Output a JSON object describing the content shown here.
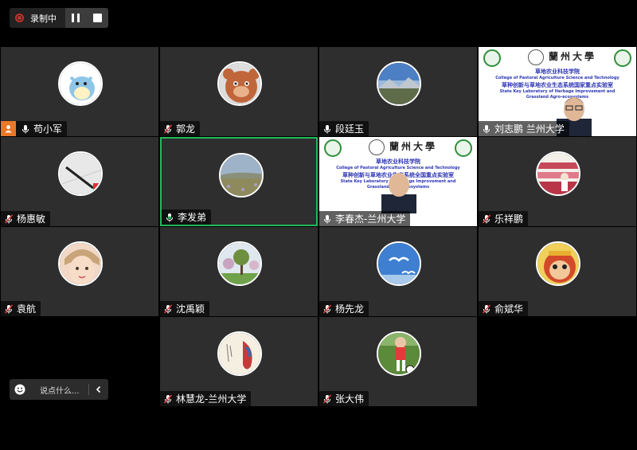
{
  "recording": {
    "label": "录制中"
  },
  "participants": [
    {
      "name": "苟小军",
      "mic": "on",
      "host": true,
      "avatar": "cartoon-dinosaur"
    },
    {
      "name": "郭龙",
      "mic": "muted",
      "avatar": "cartoon-bear"
    },
    {
      "name": "段廷玉",
      "mic": "on",
      "avatar": "mountain-lake"
    },
    {
      "name": "刘志鹏  兰州大学",
      "mic": "on",
      "avatar": "video-slide"
    },
    {
      "name": "杨惠敏",
      "mic": "muted",
      "avatar": "pen-notebook"
    },
    {
      "name": "李发弟",
      "mic": "on",
      "active": true,
      "avatar": "grassland"
    },
    {
      "name": "李春杰-兰州大学",
      "mic": "on",
      "avatar": "video-slide"
    },
    {
      "name": "乐祥鹏",
      "mic": "muted",
      "avatar": "flower-field"
    },
    {
      "name": "袁航",
      "mic": "muted",
      "avatar": "child-photo"
    },
    {
      "name": "沈禹颖",
      "mic": "muted",
      "avatar": "tree-meadow"
    },
    {
      "name": "杨先龙",
      "mic": "muted",
      "avatar": "seagulls-sky"
    },
    {
      "name": "俞斌华",
      "mic": "muted",
      "avatar": "cartoon-monkey"
    },
    {
      "name": "林慧龙-兰州大学",
      "mic": "muted",
      "avatar": "parrot-painting"
    },
    {
      "name": "张大伟",
      "mic": "muted",
      "avatar": "soccer-kid"
    }
  ],
  "slide": {
    "university": "蘭州大學",
    "university_en": "LANZHOU UNIVERSITY",
    "college_cn": "草地农业科技学院",
    "college_en": "College of Pastoral Agriculture Science and Technology",
    "lab_cn": "草种创新与草地农业生态系统国家重点实验室",
    "lab_en_1": "State Key Laboratory of Herbage Improvement and",
    "lab_en_2": "Grassland Agro-ecosystems",
    "lab_cn_short": "草种创新与草地农业生态系统全国重点实验室"
  },
  "chat": {
    "placeholder": "说点什么..."
  },
  "colors": {
    "active_border": "#22b95a",
    "host_badge": "#e8782a",
    "tile_bg": "#2e2e2e",
    "recording": "#c0332c"
  }
}
